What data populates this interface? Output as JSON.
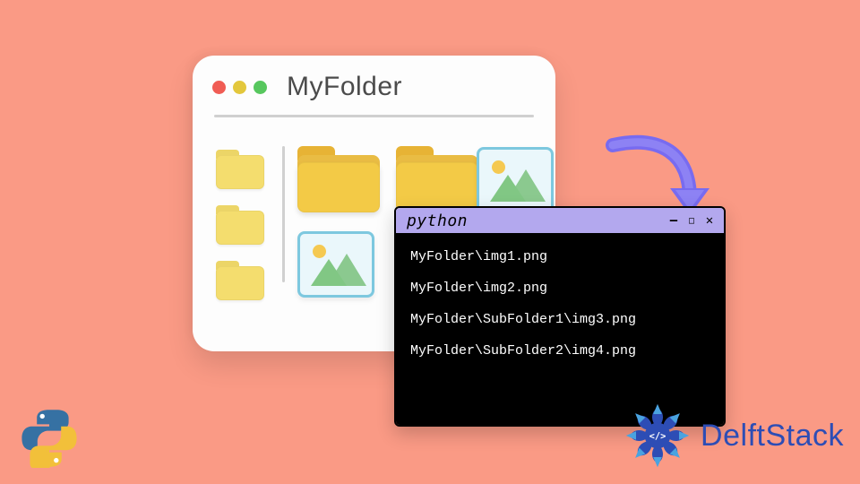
{
  "file_manager": {
    "title": "MyFolder",
    "sidebar_items": [
      "folder",
      "folder",
      "folder"
    ],
    "main_items": [
      "folder-large",
      "folder-large",
      "image",
      "image"
    ]
  },
  "terminal": {
    "title": "python",
    "output_lines": [
      "MyFolder\\img1.png",
      "MyFolder\\img2.png",
      "MyFolder\\SubFolder1\\img3.png",
      "MyFolder\\SubFolder2\\img4.png"
    ],
    "controls": {
      "minimize": "—",
      "maximize": "□",
      "close": "✕"
    }
  },
  "branding": {
    "delftstack_text": "DelftStack"
  },
  "colors": {
    "background": "#fa9a85",
    "terminal_titlebar": "#b3a8ee",
    "arrow": "#786bf0",
    "delftstack_blue": "#2d4db5"
  }
}
